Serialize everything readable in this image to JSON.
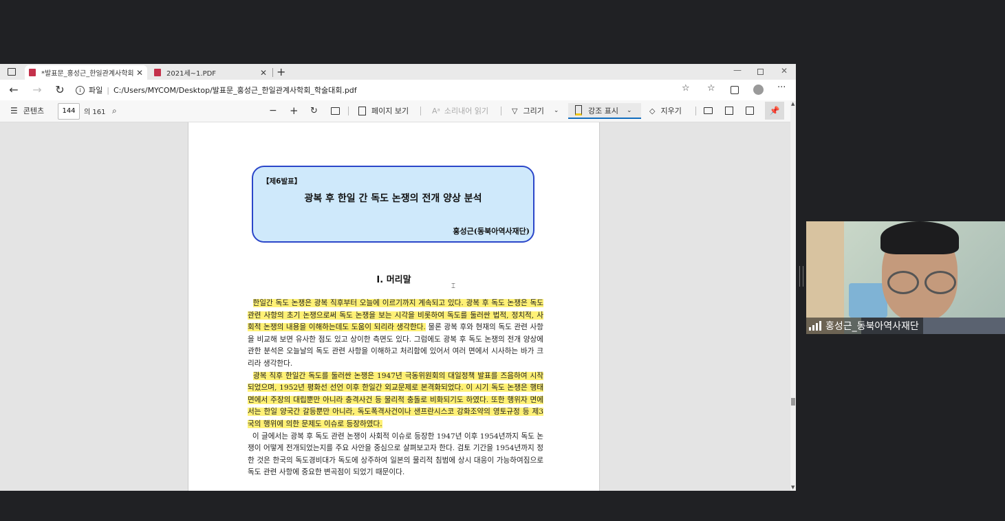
{
  "tabs": [
    {
      "title": "*발표문_홍성근_한일관계사학회_학술대회.pdf",
      "active": true
    },
    {
      "title": "2021세~1.PDF",
      "active": false
    }
  ],
  "address": {
    "label": "파일",
    "url": "C:/Users/MYCOM/Desktop/발표문_홍성근_한일관계사학회_학술대회.pdf"
  },
  "toolbar": {
    "contents": "콘텐츠",
    "page": "144",
    "page_total": "의 161",
    "page_view": "페이지 보기",
    "read_aloud": "소리내어 읽기",
    "draw": "그리기",
    "highlight": "강조 표시",
    "erase": "지우기"
  },
  "document": {
    "tag": "【제6발표】",
    "title": "광복 후 한일 간 독도 논쟁의 전개 양상 분석",
    "author": "홍성근(동북아역사재단)",
    "section": "Ⅰ. 머리말",
    "p1_highlight": "한일간 독도 논쟁은 광복 직후부터 오늘에 이르기까지 계속되고 있다. 광복 후 독도 논쟁은 독도 관련 사항의 초기 논쟁으로써 독도 논쟁을 보는 시각을 비롯하여 독도를 둘러싼 법적, 정치적, 사회적 논쟁의 내용을 이해하는데도 도움이 되리라 생각한다.",
    "p1_rest": " 물론 광복 후와 현재의 독도 관련 사항을 비교해 보면 유사한 점도 있고 상이한 측면도 있다. 그럼에도 광복 후 독도 논쟁의 전개 양상에 관한 분석은 오늘날의 독도 관련 사항을 이해하고 처리함에 있어서 여러 면에서 시사하는 바가 크리라 생각한다.",
    "p2_highlight": "광복 직후 한일간 독도를 둘러싼 논쟁은 1947년 극동위원회의 대일정책 발표를 즈음하여 시작되었으며, 1952년 평화선 선언 이후 한일간 외교문제로 본격화되었다. 이 시기 독도 논쟁은 행태 면에서 주장의 대립뿐만 아니라 충격사건 등 물리적 충돌로 비화되기도 하였다. 또한 행위자 면에서는 한일 양국간 갈등뿐만 아니라, 독도폭격사건이나 샌프란시스코 강화조약의 영토규정 등 제3국의 행위에 의한 문제도 이슈로 등장하였다.",
    "p3": "이 글에서는 광복 후 독도 관련 논쟁이 사회적 이슈로 등장한 1947년 이후 1954년까지 독도 논쟁이 어떻게 전개되었는지를 주요 사안을 중심으로 살펴보고자 한다. 검토 기간을 1954년까지 정한 것은 한국의 독도경비대가 독도에 상주하여 일본의 물리적 침범에 상시 대응이 가능하여짐으로 독도 관련 사항에 중요한 변곡점이 되었기 때문이다."
  },
  "participant": {
    "name": "홍성근_동북아역사재단"
  },
  "colors": {
    "highlight": "#fff176",
    "title_box": "#cfe9fb",
    "title_border": "#2a46c9",
    "accent": "#0f6cbd"
  }
}
